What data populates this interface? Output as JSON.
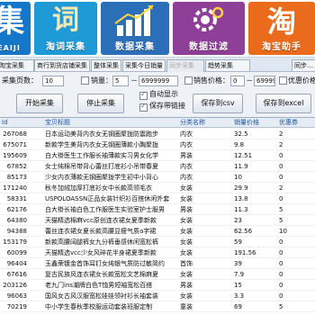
{
  "banner": {
    "tiles": [
      {
        "big": "集",
        "label": "EAIJI"
      },
      {
        "big": "词",
        "label": "淘词采集"
      },
      {
        "big": "",
        "label": "数据采集"
      },
      {
        "big": "",
        "label": "数据过滤"
      },
      {
        "big": "淘",
        "label": "淘宝助手"
      }
    ]
  },
  "tabs": [
    "淘宝采集",
    "商行到货店铺采集",
    "整体采集",
    "采集今日销量",
    "同步采集",
    "趋势采集"
  ],
  "tab_active_index": 4,
  "tab_right_label": "同步…",
  "form": {
    "pages_label": "采集页数：",
    "pages_value": "10",
    "sales_label": "销量：",
    "sales_min": "5",
    "sales_sep": "－",
    "sales_max": "6999999",
    "price_label": "销售价格：",
    "price_min": "0",
    "price_max": "6999999",
    "priority_label": "优惠价格",
    "start_button": "开始采集",
    "stop_button": "停止采集",
    "auto_show_label": "自动显示",
    "keep_link_label": "保存带链接",
    "save_csv_button": "保存到csv",
    "save_excel_button": "保存到excel"
  },
  "table": {
    "headers": [
      "Id",
      "宝贝标题",
      "分类名称",
      "销量价格",
      "优惠券"
    ],
    "rows": [
      [
        "267068",
        "日本运动美背内衣女无钢圈聚拢防震跑步",
        "内衣",
        "32.5",
        "2"
      ],
      [
        "675071",
        "新款学生美背内衣女无钢圈薄款小胸聚拢",
        "内衣",
        "9.8",
        "2"
      ],
      [
        "195609",
        "白大褂医生工作服长袖薄款实习男女化学",
        "男装",
        "12.51",
        "0"
      ],
      [
        "67852",
        "女士纯棉吊带背心蕾丝打底衫小吊带春夏",
        "内衣",
        "11.9",
        "0"
      ],
      [
        "85173",
        "少女内衣薄款无钢圈聚拢学生初中小背心",
        "内衣",
        "10",
        "0"
      ],
      [
        "171240",
        "秋冬加绒加厚打底衫女中长款高领毛衣",
        "女装",
        "29.9",
        "2"
      ],
      [
        "58331",
        "USPOLOASSN正品女装针织衫百搭休闲外套",
        "女装",
        "13.8",
        "0"
      ],
      [
        "62176",
        "白大褂长袖白色工作服医生实验室护士服男",
        "男装",
        "11.3",
        "5"
      ],
      [
        "64380",
        "天猫精选棉麻vcc原创连衣裙女夏季新款",
        "女装",
        "23",
        "5"
      ],
      [
        "94388",
        "蕾丝连衣裙女夏长款高腰显瘦气质a字裙",
        "女装",
        "62.56",
        "10"
      ],
      [
        "153179",
        "新款高腰阔腿裤女九分裤垂感休闲宽松裤",
        "女装",
        "59",
        "0"
      ],
      [
        "60099",
        "天猫精选vcc少女风碎花半身裙夏季新款",
        "女装",
        "191.56",
        "0"
      ],
      [
        "96404",
        "玉鑫荣镀金首饰耳钉女纯银气质防过敏简约",
        "首饰",
        "39",
        "0"
      ],
      [
        "67616",
        "复古民族风连衣裙女长款宽松文艺棉麻夏",
        "女装",
        "7.9",
        "0"
      ],
      [
        "203126",
        "老九门ins潮牌白色T恤男短袖宽松百搭",
        "男装",
        "15",
        "0"
      ],
      [
        "96063",
        "国风女古风汉服宽松娃娃领衬衫长袖套装",
        "女装",
        "3.3",
        "0"
      ],
      [
        "70219",
        "中小学生春秋季校服运动套装班服定制",
        "童装",
        "69",
        "5"
      ]
    ]
  }
}
